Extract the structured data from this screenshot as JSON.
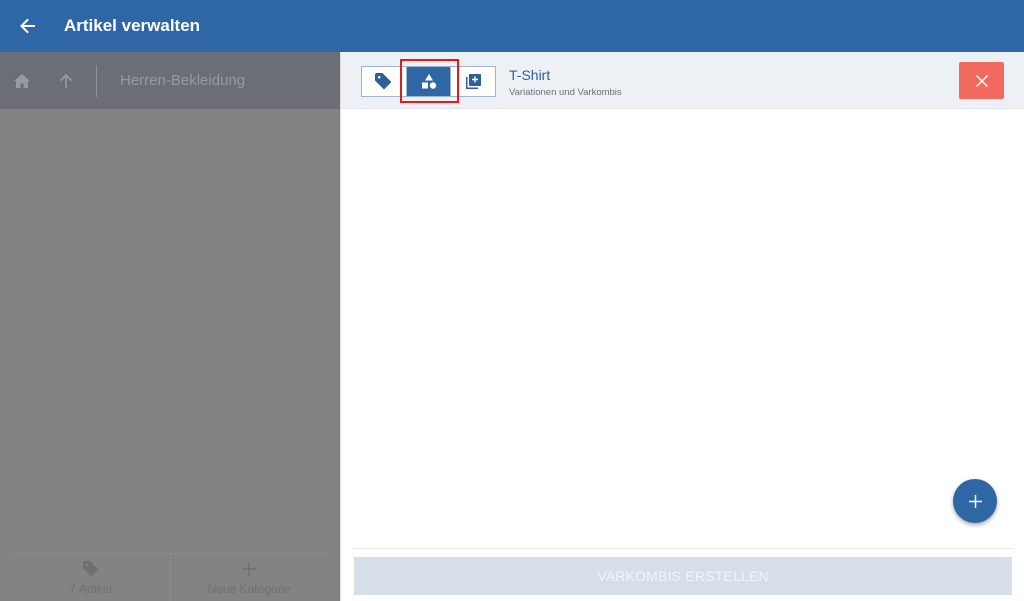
{
  "appbar": {
    "title": "Artikel verwalten",
    "back_icon": "arrow-left-icon"
  },
  "left": {
    "breadcrumb": "Herren-Bekleidung",
    "footer": {
      "articles_label": "7 Artikel",
      "new_category_label": "Neue Kategorie"
    }
  },
  "right": {
    "title": "T-Shirt",
    "subtitle": "Variationen und Varkombis",
    "tabs": [
      {
        "icon": "tag-icon",
        "active": false
      },
      {
        "icon": "shapes-icon",
        "active": true
      },
      {
        "icon": "add-copy-icon",
        "active": false
      }
    ],
    "create_button_label": "VARKOMBIS ERSTELLEN"
  },
  "colors": {
    "primary": "#2f67a6",
    "close": "#f26a5f",
    "highlight": "#e01d1d"
  }
}
